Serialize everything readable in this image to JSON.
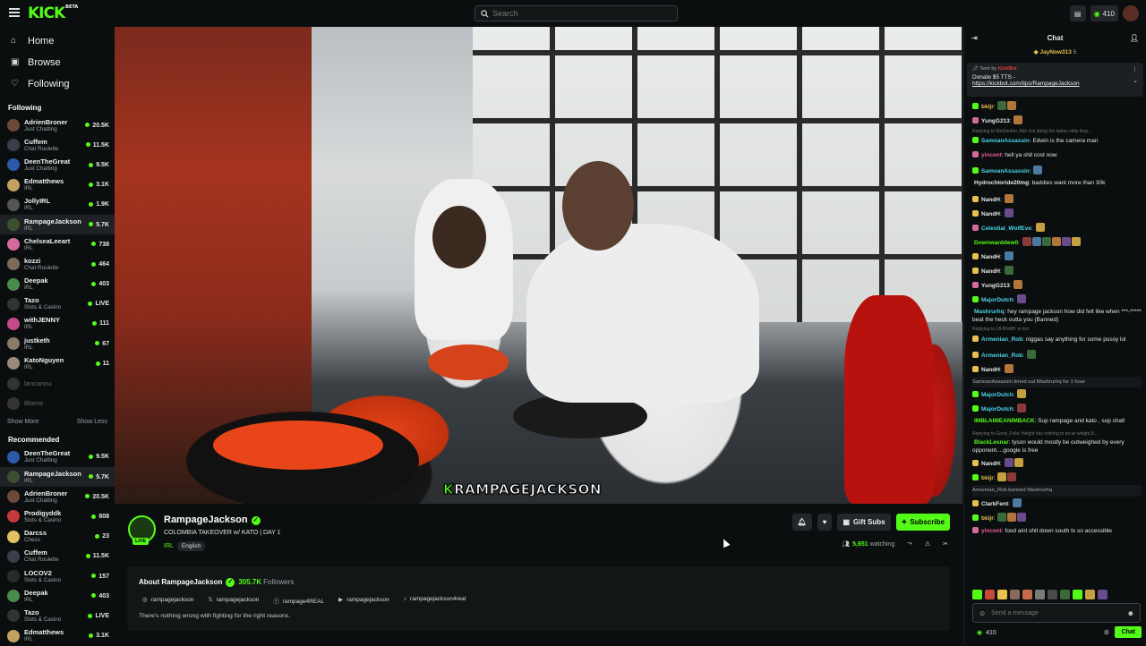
{
  "brand": {
    "logo": "KICK",
    "beta": "BETA",
    "accent": "#53fc18",
    "bg": "#0b0e0f"
  },
  "search": {
    "placeholder": "Search"
  },
  "topbar": {
    "credits": "410"
  },
  "nav": [
    {
      "label": "Home",
      "icon": "home-icon"
    },
    {
      "label": "Browse",
      "icon": "browse-icon"
    },
    {
      "label": "Following",
      "icon": "heart-icon"
    }
  ],
  "following": {
    "title": "Following",
    "channels": [
      {
        "name": "AdrienBroner",
        "category": "Just Chatting",
        "viewers": "20.5K",
        "color": "#6b4a3a"
      },
      {
        "name": "Cuffem",
        "category": "Chat Roulette",
        "viewers": "11.5K",
        "color": "#3c3c4a"
      },
      {
        "name": "DeenTheGreat",
        "category": "Just Chatting",
        "viewers": "9.5K",
        "color": "#2b5aa8"
      },
      {
        "name": "Edmatthews",
        "category": "IRL",
        "viewers": "3.1K",
        "color": "#c2a060"
      },
      {
        "name": "JollyIRL",
        "category": "IRL",
        "viewers": "1.9K",
        "color": "#555"
      },
      {
        "name": "RampageJackson",
        "category": "IRL",
        "viewers": "5.7K",
        "color": "#3a5030"
      },
      {
        "name": "ChelseaLeeart",
        "category": "IRL",
        "viewers": "738",
        "color": "#d46aa0"
      },
      {
        "name": "kozzi",
        "category": "Chat Roulette",
        "viewers": "464",
        "color": "#7a6a5a"
      },
      {
        "name": "Deepak",
        "category": "IRL",
        "viewers": "403",
        "color": "#4a8a4a"
      },
      {
        "name": "Tazo",
        "category": "Slots & Casino",
        "viewers": "LIVE",
        "color": "#333"
      },
      {
        "name": "withJENNY",
        "category": "IRL",
        "viewers": "111",
        "color": "#c44a8a"
      },
      {
        "name": "justketh",
        "category": "IRL",
        "viewers": "67",
        "color": "#8a7a6a"
      },
      {
        "name": "KatoNguyen",
        "category": "IRL",
        "viewers": "11",
        "color": "#9a8a7a"
      },
      {
        "name": "lancanou",
        "category": "",
        "viewers": "",
        "color": "#333",
        "offline": true
      },
      {
        "name": "Blame",
        "category": "",
        "viewers": "",
        "color": "#333",
        "offline": true
      }
    ],
    "show_more": "Show More",
    "show_less": "Show Less"
  },
  "recommended": {
    "title": "Recommended",
    "channels": [
      {
        "name": "DeenTheGreat",
        "category": "Just Chatting",
        "viewers": "9.5K",
        "color": "#2b5aa8"
      },
      {
        "name": "RampageJackson",
        "category": "IRL",
        "viewers": "5.7K",
        "color": "#3a5030"
      },
      {
        "name": "AdrienBroner",
        "category": "Just Chatting",
        "viewers": "20.5K",
        "color": "#6b4a3a"
      },
      {
        "name": "Prodigyddk",
        "category": "Slots & Casino",
        "viewers": "808",
        "color": "#c43a3a"
      },
      {
        "name": "Darcss",
        "category": "Chess",
        "viewers": "23",
        "color": "#e0c060"
      },
      {
        "name": "Cuffem",
        "category": "Chat Roulette",
        "viewers": "11.5K",
        "color": "#3c3c4a"
      },
      {
        "name": "LOCOV2",
        "category": "Slots & Casino",
        "viewers": "157",
        "color": "#2a2a2a"
      },
      {
        "name": "Deepak",
        "category": "IRL",
        "viewers": "403",
        "color": "#4a8a4a"
      },
      {
        "name": "Tazo",
        "category": "Slots & Casino",
        "viewers": "LIVE",
        "color": "#333"
      },
      {
        "name": "Edmatthews",
        "category": "IRL",
        "viewers": "3.1K",
        "color": "#c2a060"
      }
    ]
  },
  "video": {
    "caption_k": "K",
    "caption_rest": "RAMPAGEJACKSON"
  },
  "stream": {
    "name": "RampageJackson",
    "live": "LIVE",
    "title": "COLOMBIA TAKEOVER w/ KATO | DAY 1",
    "category": "IRL",
    "language": "English",
    "gift_subs": "Gift Subs",
    "subscribe": "Subscribe",
    "watching_count": "5,651",
    "watching_label": "watching"
  },
  "about": {
    "title": "About RampageJackson",
    "followers": "305.7K",
    "followers_label": "Followers",
    "socials": [
      {
        "icon": "instagram-icon",
        "glyph": "◎",
        "handle": "rampagejackson"
      },
      {
        "icon": "x-icon",
        "glyph": "𝕏",
        "handle": "rampagejackson"
      },
      {
        "icon": "facebook-icon",
        "glyph": "ⓕ",
        "handle": "rampage4REAL"
      },
      {
        "icon": "youtube-icon",
        "glyph": "▶",
        "handle": "rampagejackson"
      },
      {
        "icon": "tiktok-icon",
        "glyph": "♪",
        "handle": "rampagejackson4real"
      }
    ],
    "bio": "There's nothing wrong with fighting for the right reasons."
  },
  "chat": {
    "title": "Chat",
    "top_gifter": "JayNow313",
    "top_gifter_count": "5",
    "pinned": {
      "sent_by": "Sent by",
      "bot": "KickBot",
      "message": "Donate $5 TTS -",
      "link": "https://kickbot.com/tips/RampageJackson"
    },
    "messages": [
      {
        "user": "bkijr",
        "color": "#e8c14a",
        "text": "",
        "badge": "#53fc18",
        "emotes": 2
      },
      {
        "user": "YungG213",
        "color": "#e8e8e8",
        "text": "",
        "badge": "#d46aa0",
        "emotes": 1
      },
      {
        "reply": "Replying to MrGherkin: Ahh rick doing the ladies shile they..."
      },
      {
        "user": "SamoanAssassin",
        "color": "#4ad4e8",
        "text": "Edwin is the camera man",
        "badge": "#53fc18"
      },
      {
        "user": "yincent",
        "color": "#e85a9a",
        "text": "hell ya shit cost now",
        "badge": "#d46aa0"
      },
      {
        "user": "SamoanAssassin",
        "color": "#4ad4e8",
        "text": "",
        "badge": "#53fc18",
        "emotes": 1
      },
      {
        "user": "Hydrochloride20mg",
        "color": "#e8e8e8",
        "text": "baddies want more than 30k",
        "badge": ""
      },
      {
        "user": "NandH",
        "color": "#e8e8e8",
        "text": "",
        "badge": "#e8c14a",
        "emotes": 1
      },
      {
        "user": "NandH",
        "color": "#e8e8e8",
        "text": "",
        "badge": "#e8c14a",
        "emotes": 1
      },
      {
        "user": "Celestial_WolfEve",
        "color": "#4ad4e8",
        "text": "",
        "badge": "#d46aa0",
        "emotes": 1
      },
      {
        "user": "Downwarddew0",
        "color": "#53fc18",
        "text": "",
        "badge": "",
        "emotes": 6
      },
      {
        "user": "NandH",
        "color": "#e8e8e8",
        "text": "",
        "badge": "#e8c14a",
        "emotes": 1
      },
      {
        "user": "NandH",
        "color": "#e8e8e8",
        "text": "",
        "badge": "#e8c14a",
        "emotes": 1
      },
      {
        "user": "YungG213",
        "color": "#e8e8e8",
        "text": "",
        "badge": "#d46aa0",
        "emotes": 1
      },
      {
        "user": "MajorDutch",
        "color": "#4ad4e8",
        "text": "",
        "badge": "#53fc18",
        "emotes": 1
      },
      {
        "user": "Mashrurhq",
        "color": "#4ad4e8",
        "text": "hey rampage jackson how did felt like when ***-***** beat the heck outta you (Banned)",
        "badge": ""
      },
      {
        "reply": "Replying to LBJKin88: w rizz"
      },
      {
        "user": "Armenian_Rob",
        "color": "#4ad4e8",
        "text": "niggas say anything for some pussy lol",
        "badge": "#e8c14a"
      },
      {
        "user": "Armenian_Rob",
        "color": "#4ad4e8",
        "text": "",
        "badge": "#e8c14a",
        "emotes": 1
      },
      {
        "user": "NandH",
        "color": "#e8e8e8",
        "text": "",
        "badge": "#e8c14a",
        "emotes": 1
      },
      {
        "sys": "SamoanAssassin timed out Mashrurhq for 1 hour"
      },
      {
        "user": "MajorDutch",
        "color": "#4ad4e8",
        "text": "",
        "badge": "#53fc18",
        "emotes": 1
      },
      {
        "user": "MajorDutch",
        "color": "#4ad4e8",
        "text": "",
        "badge": "#53fc18",
        "emotes": 1
      },
      {
        "user": "IMBLAIMEANIMBACK",
        "color": "#53fc18",
        "text": "Sup rampage and kato , sup chat!",
        "badge": ""
      },
      {
        "reply": "Replying to Good_Folio: Height has nothing to do w/ weight 8..."
      },
      {
        "user": "BlackLesnar",
        "color": "#53fc18",
        "text": "tyson would mostly be outweighed by every opponent....google is free",
        "badge": ""
      },
      {
        "user": "NandH",
        "color": "#e8e8e8",
        "text": "",
        "badge": "#e8c14a",
        "emotes": 2
      },
      {
        "user": "bkijr",
        "color": "#e8c14a",
        "text": "",
        "badge": "#53fc18",
        "emotes": 2
      },
      {
        "sys": "Armenian_Rob banned Mashrurhq"
      },
      {
        "user": "ClarkFent",
        "color": "#e8e8e8",
        "text": "",
        "badge": "#e8c14a",
        "emotes": 1
      },
      {
        "user": "bkijr",
        "color": "#e8c14a",
        "text": "",
        "badge": "#53fc18",
        "emotes": 3
      },
      {
        "user": "yincent",
        "color": "#e85a9a",
        "text": "food aint shit down south ts so accessible",
        "badge": "#d46aa0"
      }
    ],
    "input_placeholder": "Send a message",
    "points": "410",
    "send": "Chat"
  }
}
